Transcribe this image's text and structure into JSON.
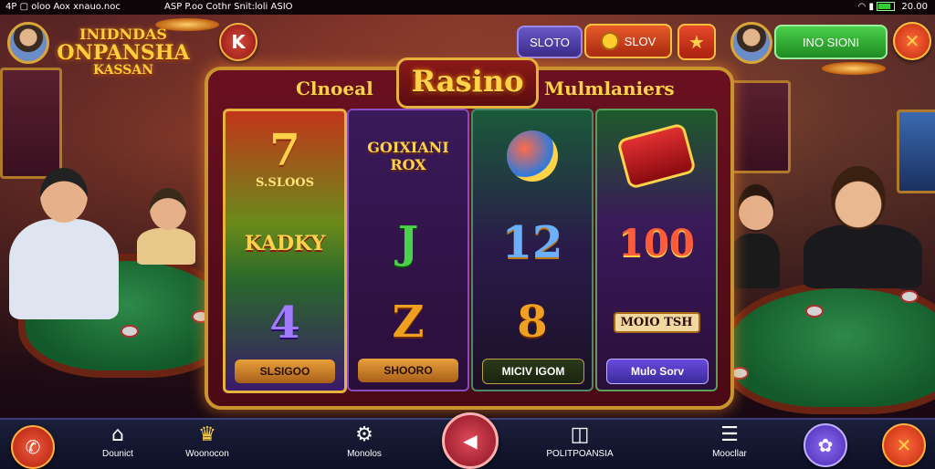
{
  "status_bar": {
    "left": "4P ▢ oloo Aox xnauo.noc",
    "center": "ASP  P.oo Cothr Snit:loli ASIO",
    "right": "20.00"
  },
  "top_bar": {
    "logo_lines": [
      "INIDNDAS",
      "ONPANSHA",
      "KASSAN"
    ],
    "back_label": "K",
    "sloto_label": "SLOTO",
    "slov_label": "SLOV",
    "star_label": "★",
    "ino_label": "INO SIONI",
    "close_label": "✕"
  },
  "machine": {
    "header_left": "Clnoeal",
    "header_center": "Rasino",
    "header_right": "Mulmlaniers",
    "reels": [
      {
        "top_label": "S.SLOOS",
        "mid_label": "KADKY",
        "bot_symbol": "4",
        "button": "SLSIGOO"
      },
      {
        "top_label": "GOIXIANI ROX",
        "mid_symbol": "J",
        "bot_symbol": "Z",
        "button": "SHOORO"
      },
      {
        "mid_symbol": "12",
        "bot_symbol": "8",
        "button": "MICIV IGOM"
      },
      {
        "mid_symbol": "100",
        "bot_label": "MOIO TSH",
        "button": "Mulo Sorv"
      }
    ]
  },
  "bottom_nav": [
    {
      "label": "Dounict",
      "icon": "⌂"
    },
    {
      "label": "Woonocon",
      "icon": "♛"
    },
    {
      "label": "Monolos",
      "icon": "⚙"
    },
    {
      "label": "POLITPOANSIA",
      "icon": "◫"
    },
    {
      "label": "Moocllar",
      "icon": "☰"
    }
  ],
  "colors": {
    "gold": "#ffd24a",
    "maroon": "#6a1020",
    "green": "#3db83a",
    "red": "#d8402a",
    "purple": "#6a3fd0"
  }
}
